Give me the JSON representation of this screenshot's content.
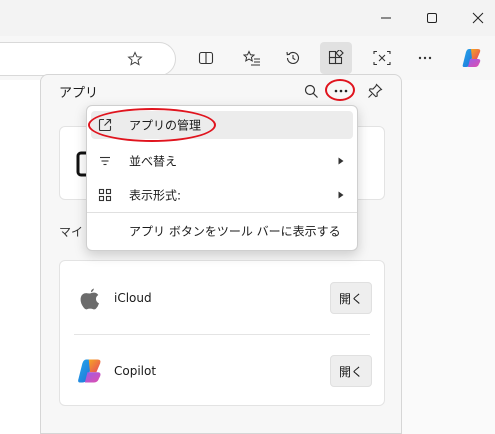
{
  "window": {
    "minimize_icon": "minimize-icon",
    "maximize_icon": "maximize-icon",
    "close_icon": "close-icon"
  },
  "toolbar": {
    "favorite_icon": "star-icon",
    "buttons": [
      "split-screen-icon",
      "favorites-icon",
      "history-icon",
      "apps-icon",
      "screenshot-icon",
      "more-icon",
      "copilot-icon"
    ]
  },
  "panel": {
    "title": "アプリ",
    "section_label": "マイ",
    "apps": [
      {
        "name": "iCloud",
        "open_label": "開く",
        "logo": "apple-logo"
      },
      {
        "name": "Copilot",
        "open_label": "開く",
        "logo": "copilot-logo"
      }
    ]
  },
  "menu": {
    "items": [
      {
        "label": "アプリの管理",
        "icon": "open-external-icon",
        "submenu": false
      },
      {
        "label": "並べ替え",
        "icon": "sort-icon",
        "submenu": true
      },
      {
        "label": "表示形式:",
        "icon": "grid-icon",
        "submenu": true
      },
      {
        "label": "アプリ ボタンをツール バーに表示する",
        "icon": "",
        "submenu": false
      }
    ]
  },
  "colors": {
    "highlight_red": "#e0141e",
    "panel_bg": "#f7f7f7",
    "card_bg": "#ffffff"
  }
}
